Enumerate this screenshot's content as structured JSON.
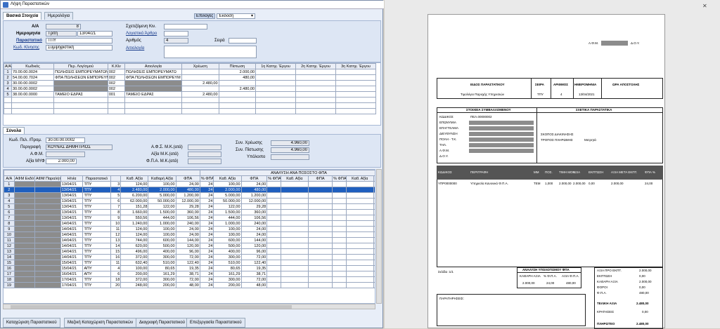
{
  "window": {
    "title": "Λήψη Παραστατικών"
  },
  "tabs": [
    "Βασικά Στοιχεία",
    "Ημερολόγια"
  ],
  "toolbar": {
    "select_label": "Επιλογές",
    "print_label": "Έκδοση"
  },
  "header": {
    "aa_label": "Α/Α",
    "aa_value": "8",
    "date_label": "Ημερομηνία",
    "day_value": "Τρίτη",
    "date_value": "13/04/21",
    "doc_label": "Παραστατικό",
    "doc_value": "ΤΠΥ",
    "movcode_label": "Κωδ. Κίνησης",
    "movcode_value": "Συμψηφιστική",
    "ext_label": "Σχετιζόμενη Κιν.",
    "acc_label": "Λογιστικό Άρθρο",
    "num_label": "Αριθμός",
    "num_value": "4",
    "series_label": "Σειρά",
    "reason_label": "Αιτιολογία"
  },
  "ledger": {
    "columns": [
      "Α/Α",
      "Κωδικός",
      "Περ. Λογ/σμού",
      "Κ.Κίν",
      "Αιτιολογία",
      "Χρέωση",
      "Πίστωση",
      "1η Κατηγ. Έργου",
      "2η Κατηγ. Έργου",
      "3η Κατηγ. Έργου"
    ],
    "rows": [
      [
        "1",
        "70.00.00.0024",
        "ΠΩΛΗΣΕΙΣ ΕΜΠΟΡΕΥΜΑΤΩΝ ΕΣΩΤ",
        "002",
        "ΠΩΛΗΣΕΙΣ ΕΜΠΟΡΕΥΜΑΤΩ",
        "",
        "2.000,00",
        "",
        "",
        ""
      ],
      [
        "2",
        "54.00.00.7024",
        "ΦΠΑ ΠΩΛΗΣΕΩΝ ΕΜΠΟΡΕΥΜΑΤΩΝ",
        "002",
        "ΦΠΑ ΠΩΛΗΣΕΩΝ ΕΜΠΟΡΕΥΜ",
        "",
        "480,00",
        "",
        "",
        ""
      ],
      [
        "3",
        "30.00.00.0002",
        "",
        "002",
        "",
        "2.480,00",
        "",
        "",
        "",
        ""
      ],
      [
        "4",
        "30.00.00.0002",
        "",
        "002",
        "",
        "",
        "2.480,00",
        "",
        "",
        ""
      ],
      [
        "5",
        "38.00.00.0000",
        "ΤΑΜΕΙΟ ΕΔΡΑΣ",
        "001",
        "ΤΑΜΕΙΟ ΕΔΡΑΣ",
        "2.480,00",
        "",
        "",
        "",
        ""
      ]
    ]
  },
  "totals": {
    "title": "Σύνολα",
    "code_label": "Κωδ. Πελ. /Προμ.",
    "code_value": "30.00.00.0002",
    "desc_label": "Περιγραφή",
    "desc_value": "ΚΟΥΝΑΣ ΔΗΜΗΤΡΙΟΣ",
    "afm_label": "Α.Φ.Μ.",
    "amount_label": "Αξία ΜΥΦ",
    "amount_value": "2.000,00",
    "fps_label": "Α.Φ.Σ. Μ.Κ.(ατά)",
    "val_label": "Αξία Μ.Κ.(ατά)",
    "fpa_label": "Φ.Π.Α. Μ.Κ.(ατά)",
    "debit_label": "Συν. Χρέωσης",
    "debit_value": "4.960,00",
    "credit_label": "Συν. Πίστωσης",
    "credit_value": "4.960,00",
    "balance_label": "Υπόλοιπο"
  },
  "grid": {
    "columns": [
      "Α/Α",
      "ΑΦΜ Εκδότη",
      "ΑΦΜ Παραλήπτη",
      "Η/νία",
      "Παραστατικό",
      "",
      "Καθ. Αξία",
      "Καθαρή Αξία",
      "ΦΠΑ",
      "% ΦΠΑ",
      "Καθ. Αξία",
      "ΦΠΑ",
      "% ΦΠΑ",
      "Καθ. Αξία",
      "ΦΠΑ",
      "% ΦΠΑ",
      "Καθ. Αξία",
      "ΦΠΑ",
      "% ΦΠΑ",
      "Καθ. Αξία"
    ],
    "group_label": "ΑΝΑΛΥΣΗ ΑΝΑ ΠΟΣΟΣΤΟ ΦΠΑ",
    "rows": [
      [
        "1",
        "13/04/21",
        "ΤΠΥ",
        "3",
        "124,00",
        "100,00",
        "24,00",
        "24",
        "100,00",
        "24,00"
      ],
      [
        "2",
        "13/04/21",
        "ΤΠΥ",
        "4",
        "2.480,00",
        "2.000,00",
        "480,00",
        "24",
        "2.000,00",
        "480,00"
      ],
      [
        "3",
        "13/04/21",
        "ΤΠΥ",
        "5",
        "6.200,00",
        "5.000,00",
        "1.200,00",
        "24",
        "5.000,00",
        "1.200,00"
      ],
      [
        "4",
        "13/04/21",
        "ΤΠΥ",
        "6",
        "62.000,00",
        "50.000,00",
        "12.000,00",
        "24",
        "50.000,00",
        "12.000,00"
      ],
      [
        "5",
        "13/04/21",
        "ΤΠΥ",
        "7",
        "151,28",
        "122,00",
        "29,28",
        "24",
        "122,00",
        "29,28"
      ],
      [
        "6",
        "13/04/21",
        "ΤΠΥ",
        "8",
        "1.660,00",
        "1.500,00",
        "360,00",
        "24",
        "1.500,00",
        "360,00"
      ],
      [
        "7",
        "13/04/21",
        "ΤΠΥ",
        "9",
        "550,56",
        "444,00",
        "106,56",
        "24",
        "444,00",
        "106,56"
      ],
      [
        "8",
        "14/04/21",
        "ΤΠΥ",
        "10",
        "1.240,00",
        "1.000,00",
        "240,00",
        "24",
        "1.000,00",
        "240,00"
      ],
      [
        "9",
        "14/04/21",
        "ΤΠΥ",
        "11",
        "124,00",
        "100,00",
        "24,00",
        "24",
        "100,00",
        "24,00"
      ],
      [
        "10",
        "14/04/21",
        "ΤΠΥ",
        "12",
        "124,00",
        "100,00",
        "24,00",
        "24",
        "100,00",
        "24,00"
      ],
      [
        "11",
        "14/04/21",
        "ΤΠΥ",
        "13",
        "744,00",
        "600,00",
        "144,00",
        "24",
        "600,00",
        "144,00"
      ],
      [
        "12",
        "14/04/21",
        "ΤΠΥ",
        "14",
        "620,00",
        "500,00",
        "120,00",
        "24",
        "500,00",
        "120,00"
      ],
      [
        "13",
        "14/04/21",
        "ΤΠΥ",
        "15",
        "496,00",
        "400,00",
        "96,00",
        "24",
        "400,00",
        "96,00"
      ],
      [
        "14",
        "14/04/21",
        "ΤΠΥ",
        "16",
        "372,00",
        "300,00",
        "72,00",
        "24",
        "300,00",
        "72,00"
      ],
      [
        "15",
        "15/04/21",
        "ΤΠΥ",
        "11",
        "632,40",
        "510,00",
        "122,40",
        "24",
        "510,00",
        "122,40"
      ],
      [
        "16",
        "15/04/21",
        "ΑΠΥ",
        "4",
        "100,00",
        "80,65",
        "19,35",
        "24",
        "80,65",
        "19,35"
      ],
      [
        "17",
        "16/04/21",
        "ΑΠΥ",
        "6",
        "200,00",
        "161,29",
        "38,71",
        "24",
        "161,29",
        "38,71"
      ],
      [
        "18",
        "17/04/21",
        "ΤΠΥ",
        "18",
        "372,00",
        "300,00",
        "72,00",
        "24",
        "300,00",
        "72,00"
      ],
      [
        "19",
        "17/04/21",
        "ΤΠΥ",
        "20",
        "248,00",
        "200,00",
        "48,00",
        "24",
        "200,00",
        "48,00"
      ]
    ]
  },
  "bottom_tabs": [
    "Καταχώριση Παραστατικού",
    "Μαζική Καταχώριση Παραστατικών",
    "Διαγραφή Παραστατικού",
    "Επεξεργασία Παραστατικού"
  ],
  "doc": {
    "afm_label": "Α.Φ.Μ.",
    "doy_label": "Δ.Ο.Υ.",
    "hdr": [
      "ΕΙΔΟΣ ΠΑΡΑΣΤΑΤΙΚΟΥ",
      "ΣΕΙΡΑ",
      "ΑΡΙΘΜΟΣ",
      "ΗΜΕΡΟΜΗΝΙΑ",
      "ΩΡΑ ΑΠΟΣΤΟΛΗΣ"
    ],
    "hdr_vals": [
      "Τιμολόγιο Παροχής Υπηρεσιών",
      "ΤΠΥ",
      "4",
      "13/04/2021",
      ""
    ],
    "party_title": "ΣΤΟΙΧΕΙΑ ΣΥΜΒΑΛΛΟΜΕΝΟΥ",
    "related_title": "ΣΧΕΤΙΚΑ ΠΑΡΑΣΤΑΤΙΚΑ",
    "party_labels": [
      "ΚΩΔΙΚΟΣ",
      "ΕΠΩΝΥΜΙΑ",
      "ΕΠΑΓΓΕΛΜΑ",
      "ΔΙΕΥΘΥΝΣΗ",
      "ΠΟΛΗ - Τ.Κ.",
      "ΤΗΛ.",
      "Α.Φ.Μ.",
      "Δ.Ο.Υ."
    ],
    "code_value": "ΠΕΛ.00000002",
    "purpose_label": "ΣΚΟΠΟΣ ΔΙΑΚΙΝΗΣΗΣ",
    "payment_label": "ΤΡΟΠΟΣ ΠΛΗΡΩΜΗΣ",
    "payment_value": "Μετρητά",
    "item_cols": [
      "ΚΩΔΙΚΟΣ",
      "ΠΕΡΙΓΡΑΦΗ",
      "ΜΜ",
      "ΠΟΣ.",
      "ΤΙΜΗ ΜΟΝ.",
      "ΑΞΙΑ",
      "ΕΚΠΤΩΣΗ",
      "ΑΞΙΑ ΜΕΤΑ ΕΚΠΤ.",
      "ΦΠΑ %"
    ],
    "item_row": [
      "ΥΠΡ0000000",
      "Υπηρεσία Κανονικό Φ.Π.Α.",
      "ΤΕΜ",
      "1,000",
      "2.000,00",
      "2.000,00",
      "0,00",
      "2.000,00",
      "24,00"
    ],
    "page_label": "Σελίδα :1/1",
    "vat_title": "ΑΝΑΛΥΣΗ ΥΠΟΛΟΓΙΣΜΟΥ ΦΠΑ",
    "vat_cols": [
      "ΚΑΘΑΡΗ ΑΞΙΑ",
      "% Φ.Π.Α.",
      "ΑΞΙΑ Φ.Π.Α."
    ],
    "vat_vals": [
      "2.000,00",
      "24,00",
      "480,00"
    ],
    "sum_labels": [
      "ΑΞΙΑ ΠΡΟ ΕΚΠΤ.",
      "ΕΚΠΤΩΣΗ",
      "ΚΑΘΑΡΗ ΑΞΙΑ",
      "ΦΟΡΟΙ",
      "Φ.Π.Α."
    ],
    "sum_vals": [
      "2.000,00",
      "0,00",
      "2.000,00",
      "0,00",
      "480,00"
    ],
    "remarks_label": "ΠΑΡΑΤΗΡΗΣΕΙΣ:",
    "total_label": "ΤΕΛΙΚΗ ΑΞΙΑ",
    "total_value": "2.480,00",
    "prev_label": "ΚΡΑΤΗΣΕΙΣ",
    "prev_value": "0,00",
    "pay_label": "ΠΛΗΡΩΤΕΟ",
    "pay_value": "2.480,00"
  }
}
